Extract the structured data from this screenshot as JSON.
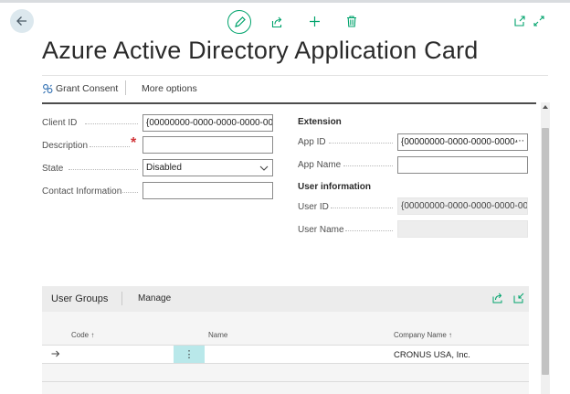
{
  "toolbar": {
    "back_icon": "arrow-left-icon",
    "edit_icon": "pencil-icon",
    "share_icon": "share-icon",
    "new_icon": "plus-icon",
    "delete_icon": "trash-icon",
    "open_new_window_icon": "open-in-new-window-icon",
    "expand_icon": "expand-icon"
  },
  "page": {
    "title": "Azure Active Directory Application Card"
  },
  "actions": {
    "grant_consent": "Grant Consent",
    "more_options": "More options"
  },
  "general": {
    "client_id": {
      "label": "Client ID",
      "value": "{00000000-0000-0000-0000-000("
    },
    "description": {
      "label": "Description",
      "value": "",
      "required_mark": "*"
    },
    "state": {
      "label": "State",
      "value": "Disabled"
    },
    "contact_information": {
      "label": "Contact Information",
      "value": ""
    }
  },
  "extension": {
    "heading": "Extension",
    "app_id": {
      "label": "App ID",
      "value": "{00000000-0000-0000-0000-",
      "more": "⋯"
    },
    "app_name": {
      "label": "App Name",
      "value": ""
    }
  },
  "user_information": {
    "heading": "User information",
    "user_id": {
      "label": "User ID",
      "value": "{00000000-0000-0000-0000-00..."
    },
    "user_name": {
      "label": "User Name",
      "value": ""
    }
  },
  "user_groups": {
    "title": "User Groups",
    "manage": "Manage",
    "columns": {
      "code": "Code ↑",
      "name": "Name",
      "company_name": "Company Name ↑"
    },
    "rows": [
      {
        "code": "",
        "name": "",
        "company_name": "CRONUS USA, Inc.",
        "row_icon": "arrow-right-icon",
        "menu": "⋮"
      }
    ]
  },
  "colors": {
    "accent_green": "#00a36c",
    "back_circle": "#dce8ee",
    "required_red": "#d13438",
    "teal_highlight": "#b9e8ea"
  }
}
